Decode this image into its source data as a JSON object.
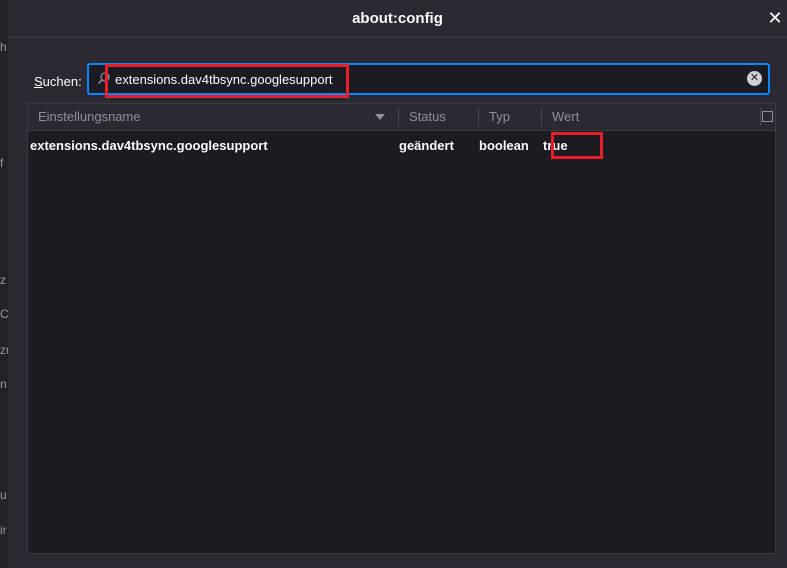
{
  "window": {
    "title": "about:config"
  },
  "background_strip": [
    "h",
    "f",
    "z",
    "C",
    "zu",
    "n",
    "u",
    "ir"
  ],
  "search": {
    "label_prefix": "",
    "label_underlined": "S",
    "label_rest": "uchen:",
    "value": "extensions.dav4tbsync.googlesupport",
    "placeholder": ""
  },
  "table": {
    "columns": [
      "Einstellungsname",
      "Status",
      "Typ",
      "Wert"
    ],
    "rows": [
      {
        "name": "extensions.dav4tbsync.googlesupport",
        "status": "geändert",
        "type": "boolean",
        "value": "true"
      }
    ]
  },
  "colors": {
    "accent": "#0a84ff",
    "highlight": "#e5202b",
    "background": "#2b2a33",
    "table_background": "#1c1b22"
  },
  "icons": {
    "close": "close-icon",
    "search": "search-icon",
    "clear": "clear-search-icon",
    "sort": "sort-descending-icon",
    "column_picker": "column-picker-icon"
  }
}
